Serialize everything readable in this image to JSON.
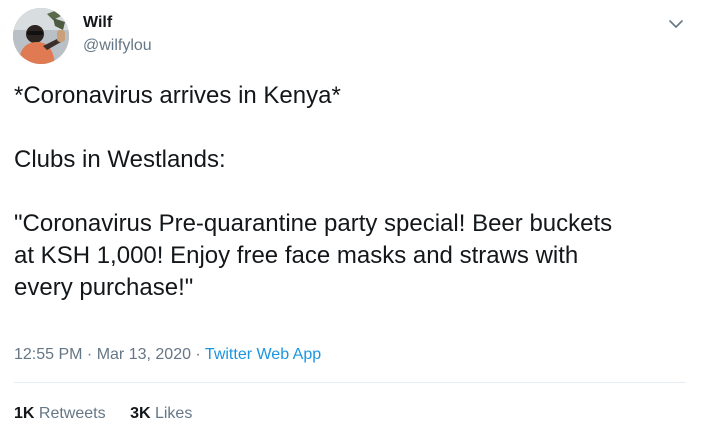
{
  "author": {
    "name": "Wilf",
    "handle": "@wilfylou"
  },
  "tweet": {
    "paragraphs": [
      "*Coronavirus arrives in Kenya*",
      "Clubs in Westlands:",
      "\"Coronavirus Pre-quarantine party special! Beer buckets\nat KSH 1,000! Enjoy free face masks and straws with\nevery purchase!\""
    ]
  },
  "meta": {
    "time": "12:55 PM",
    "separator": " · ",
    "date": "Mar 13, 2020",
    "source": "Twitter Web App"
  },
  "stats": {
    "retweets_count": "1K",
    "retweets_label": "Retweets",
    "likes_count": "3K",
    "likes_label": "Likes"
  },
  "icons": {
    "caret": "chevron-down-icon"
  },
  "colors": {
    "text": "#14171a",
    "secondary": "#657786",
    "link": "#1b95e0",
    "divider": "#e6ecf0"
  }
}
